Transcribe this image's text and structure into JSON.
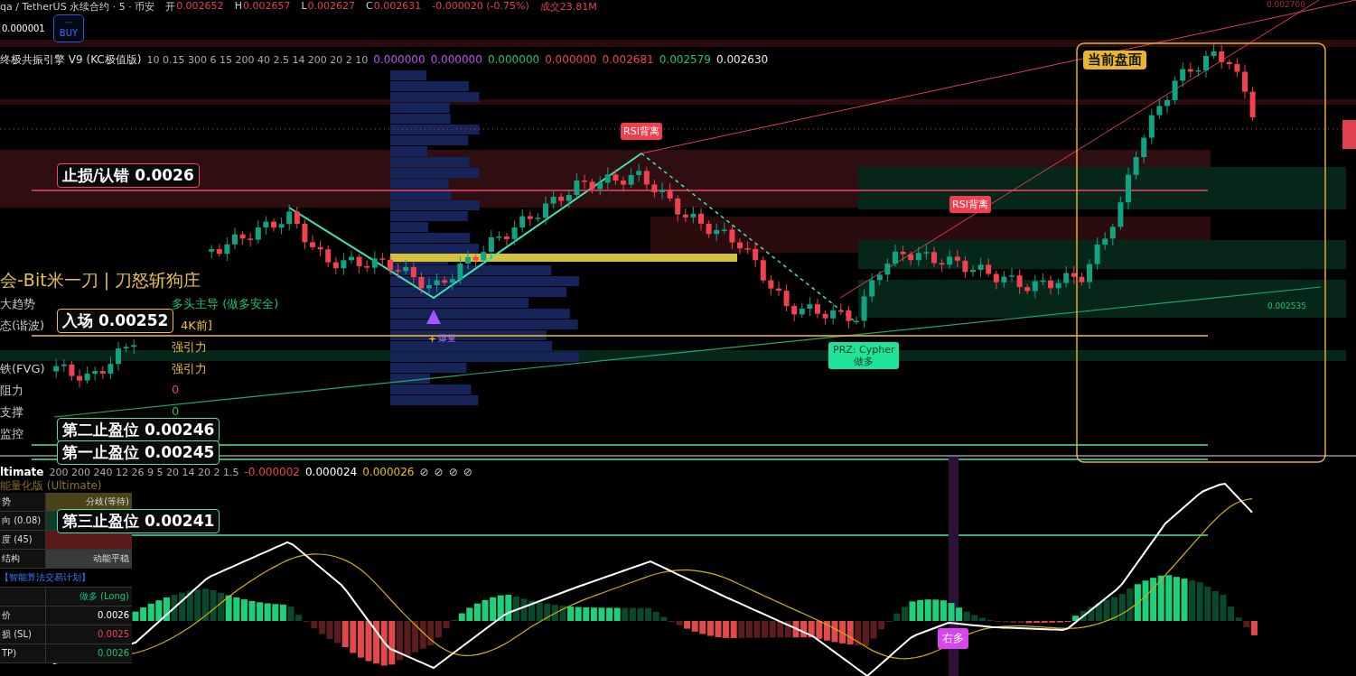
{
  "header": {
    "symbol": "qa / TetherUS 永续合约 · 5 · 币安",
    "ohlc": [
      {
        "label": "开",
        "value": "0.002652"
      },
      {
        "label": "H",
        "value": "0.002657"
      },
      {
        "label": "L",
        "value": "0.002627"
      },
      {
        "label": "C",
        "value": "0.002631"
      }
    ],
    "change": "-0.000020 (-0.75%)",
    "volume_label": "成交",
    "volume": "23.81M"
  },
  "price_step": "0.000001",
  "buy_button": {
    "dots": "···",
    "label": "BUY"
  },
  "main_legend": {
    "name": "终极共振引擎 V9 (KC极值版)",
    "params": "10 0.15 300 6 15 200 40 2.5 14 200 20 2 10",
    "values": [
      {
        "value": "0.000000",
        "color": "#c050f0"
      },
      {
        "value": "0.000000",
        "color": "#c050f0"
      },
      {
        "value": "0.000000",
        "color": "#19c37d"
      },
      {
        "value": "0.000000",
        "color": "#f0424f"
      },
      {
        "value": "0.002681",
        "color": "#f0424f"
      },
      {
        "value": "0.002579",
        "color": "#19c37d"
      },
      {
        "value": "0.002630",
        "color": "#e8e8e8"
      }
    ]
  },
  "dashboard": {
    "title": "会-Bit米一刀 | 刀怒斩狗庄",
    "rows": [
      {
        "label": "大趋势",
        "value": "多头主导 (做多安全)",
        "kind": "bull"
      },
      {
        "label": "态(谐波)",
        "value": "4K前]",
        "kind": "strong"
      },
      {
        "value": "强引力",
        "kind": "strong"
      },
      {
        "label": "铁(FVG)",
        "value": "强引力",
        "kind": "strong"
      },
      {
        "label": "阻力",
        "value": "0",
        "kind": "bear"
      },
      {
        "label": "支撑",
        "value": "0",
        "kind": "bull"
      },
      {
        "label": "监控"
      }
    ]
  },
  "price_levels": [
    {
      "text": "止损/认错 0.0026",
      "kind": "stop"
    },
    {
      "text": "入场 0.00252",
      "kind": "entry"
    },
    {
      "text": "第二止盈位 0.00246",
      "kind": "target"
    },
    {
      "text": "第一止盈位 0.00245",
      "kind": "target"
    },
    {
      "text": "第三止盈位 0.00241",
      "kind": "target"
    }
  ],
  "current_box": {
    "label": "当前盘面"
  },
  "signals": [
    {
      "text": "RSI背离",
      "kind": "rsi"
    },
    {
      "text": "RSI背离",
      "kind": "rsi"
    },
    {
      "text": "PRZ: Cypher",
      "sub": "做多",
      "kind": "prz"
    },
    {
      "text": "爆量",
      "kind": "volume"
    },
    {
      "text": "右多",
      "kind": "long"
    }
  ],
  "axis_values": [
    {
      "value": "0.002700",
      "kind": "bear"
    },
    {
      "value": "0.002535",
      "kind": "bull"
    }
  ],
  "oscillator_legend": {
    "name": "ltimate",
    "params": "200 200 240 12 26 9 5 20 14 20 2 1.5",
    "values": [
      {
        "value": "-0.000002",
        "color": "#f0424f"
      },
      {
        "value": "0.000024",
        "color": "#ffffff"
      },
      {
        "value": "0.000026",
        "color": "#e6c000"
      }
    ],
    "empty_marks": [
      "⊘",
      "⊘",
      "⊘",
      "⊘"
    ]
  },
  "oscillator_table": {
    "title": "能量化版 (Ultimate)",
    "rows": [
      {
        "label": "势",
        "value": "分歧(等待)",
        "kind": "wait"
      },
      {
        "label": "向 (0.08)",
        "kind": "bull"
      },
      {
        "label": "度 (45)",
        "kind": "bear"
      },
      {
        "label": "结构",
        "value": "动能平稳",
        "kind": "neutral"
      },
      {
        "label": "【智能算法交易计划】",
        "kind": "heading"
      },
      {
        "value": "做多 (Long)",
        "kind": "long"
      },
      {
        "label": "价",
        "value": "0.0026",
        "kind": "plain"
      },
      {
        "label": "损 (SL)",
        "value": "0.0025",
        "kind": "sl"
      },
      {
        "label": "TP)",
        "value": "0.0026",
        "kind": "tp"
      }
    ]
  }
}
